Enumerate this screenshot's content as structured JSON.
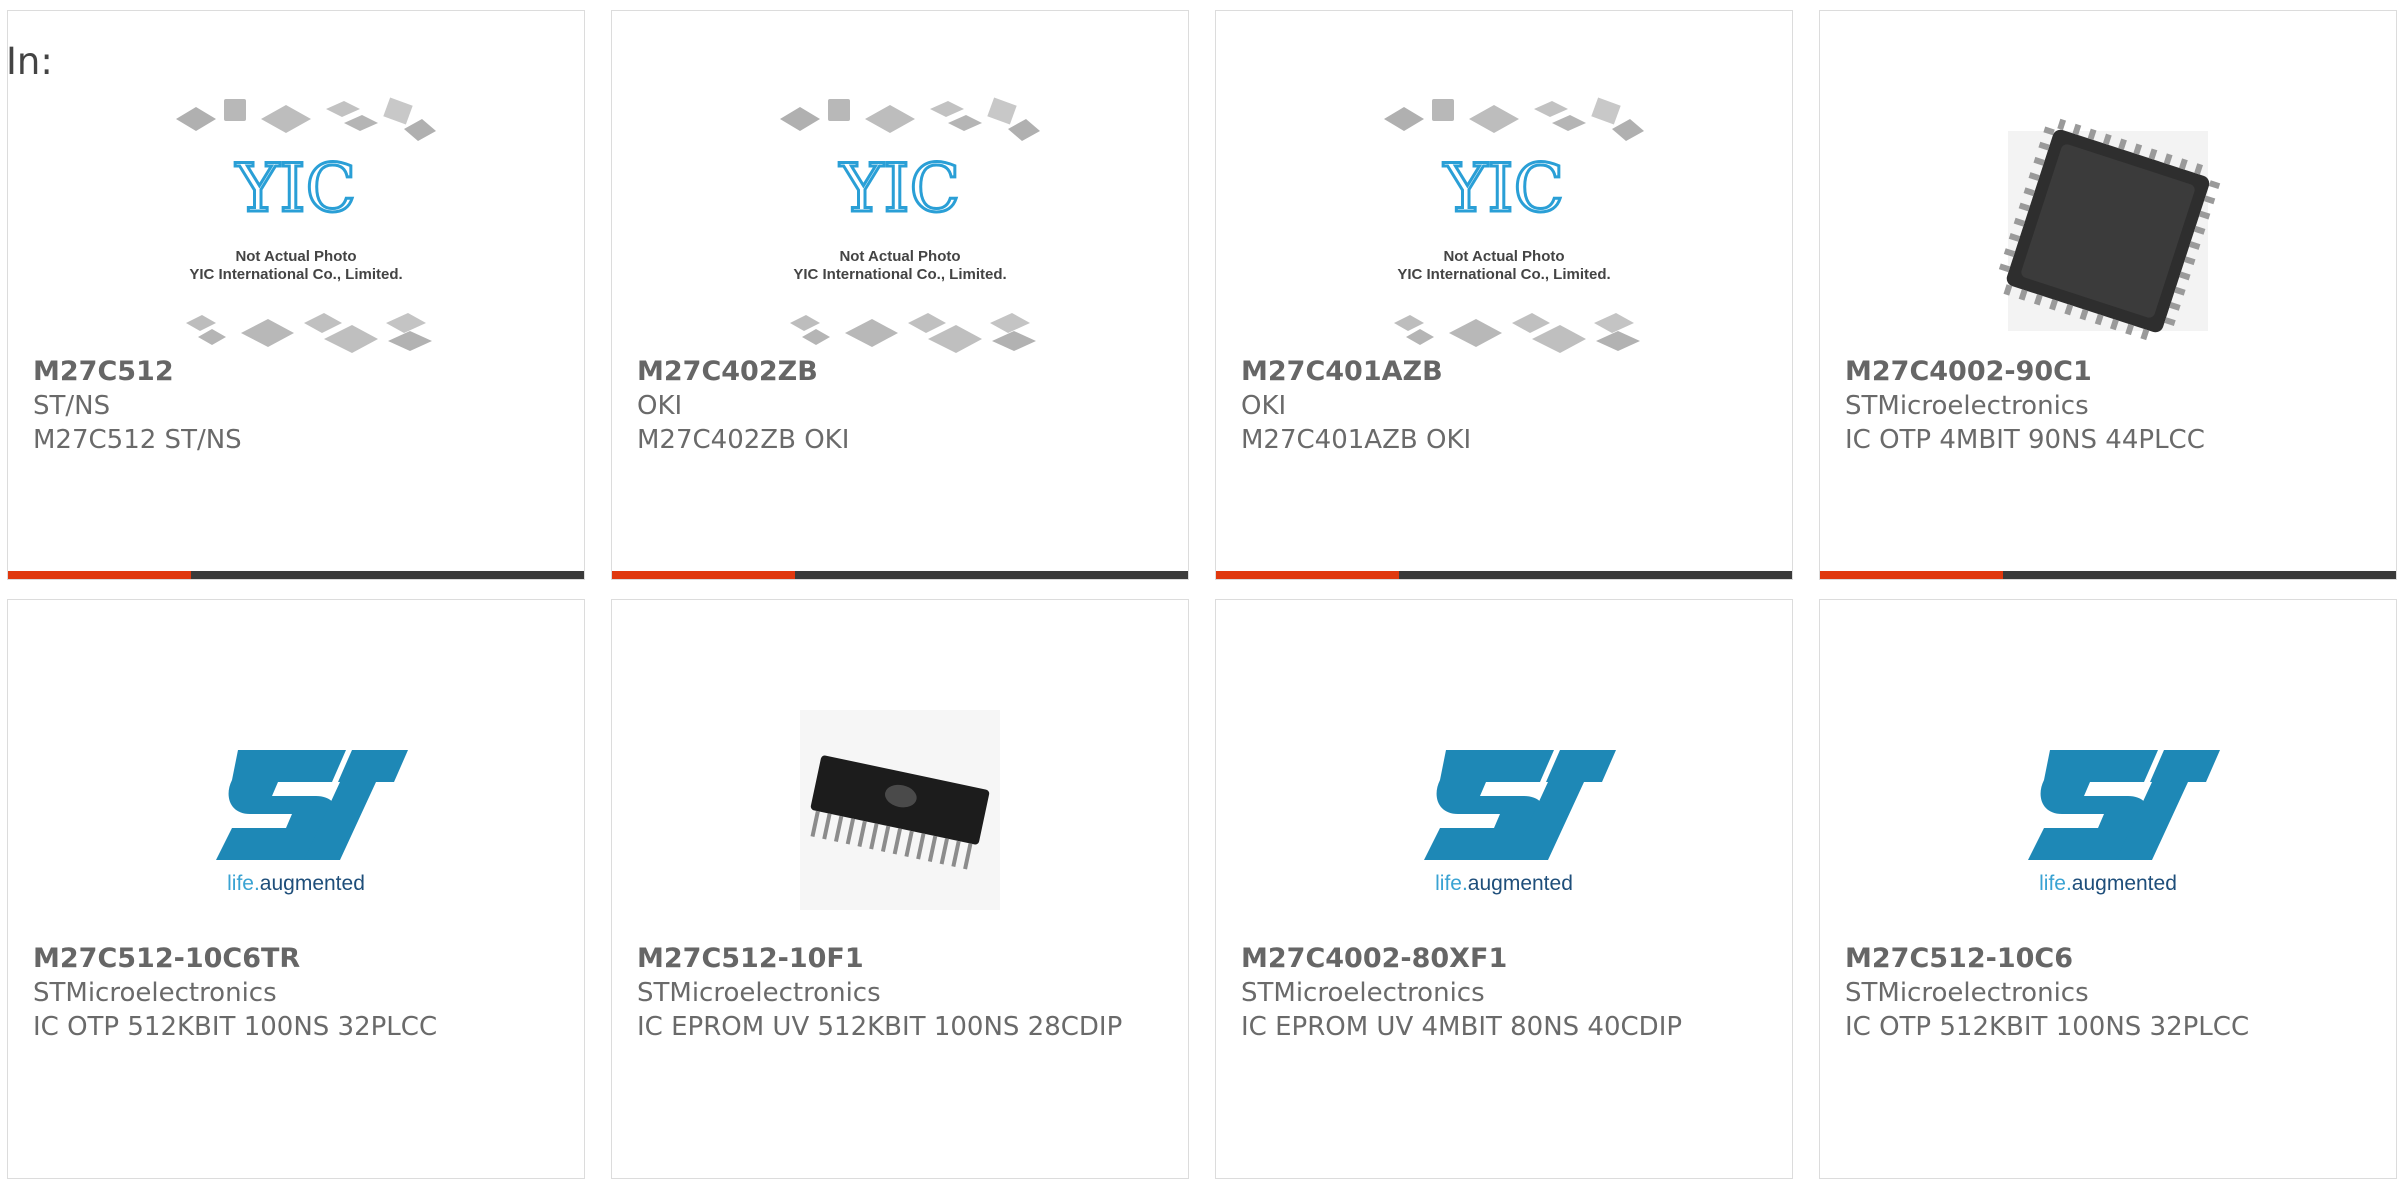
{
  "header": {
    "in_label": "In:"
  },
  "placeholder": {
    "caption_1": "Not Actual Photo",
    "caption_2": "YIC International Co., Limited.",
    "logo_text": "YIC"
  },
  "st_logo": {
    "tagline_1": "life.",
    "tagline_2": "augmented"
  },
  "colors": {
    "accent": "#e0380e",
    "bar": "#3a3a3a",
    "st_blue": "#1e88b6",
    "yic_blue": "#2a9fd6"
  },
  "products": [
    {
      "part": "M27C512",
      "manufacturer": "ST/NS",
      "description": "M27C512 ST/NS",
      "image": "yic-placeholder"
    },
    {
      "part": "M27C402ZB",
      "manufacturer": "OKI",
      "description": "M27C402ZB OKI",
      "image": "yic-placeholder"
    },
    {
      "part": "M27C401AZB",
      "manufacturer": "OKI",
      "description": "M27C401AZB OKI",
      "image": "yic-placeholder"
    },
    {
      "part": "M27C4002-90C1",
      "manufacturer": "STMicroelectronics",
      "description": "IC OTP 4MBIT 90NS 44PLCC",
      "image": "plcc-chip"
    },
    {
      "part": "M27C512-10C6TR",
      "manufacturer": "STMicroelectronics",
      "description": "IC OTP 512KBIT 100NS 32PLCC",
      "image": "st-logo"
    },
    {
      "part": "M27C512-10F1",
      "manufacturer": "STMicroelectronics",
      "description": "IC EPROM UV 512KBIT 100NS 28CDIP",
      "image": "cdip-chip"
    },
    {
      "part": "M27C4002-80XF1",
      "manufacturer": "STMicroelectronics",
      "description": "IC EPROM UV 4MBIT 80NS 40CDIP",
      "image": "st-logo"
    },
    {
      "part": "M27C512-10C6",
      "manufacturer": "STMicroelectronics",
      "description": "IC OTP 512KBIT 100NS 32PLCC",
      "image": "st-logo"
    }
  ]
}
